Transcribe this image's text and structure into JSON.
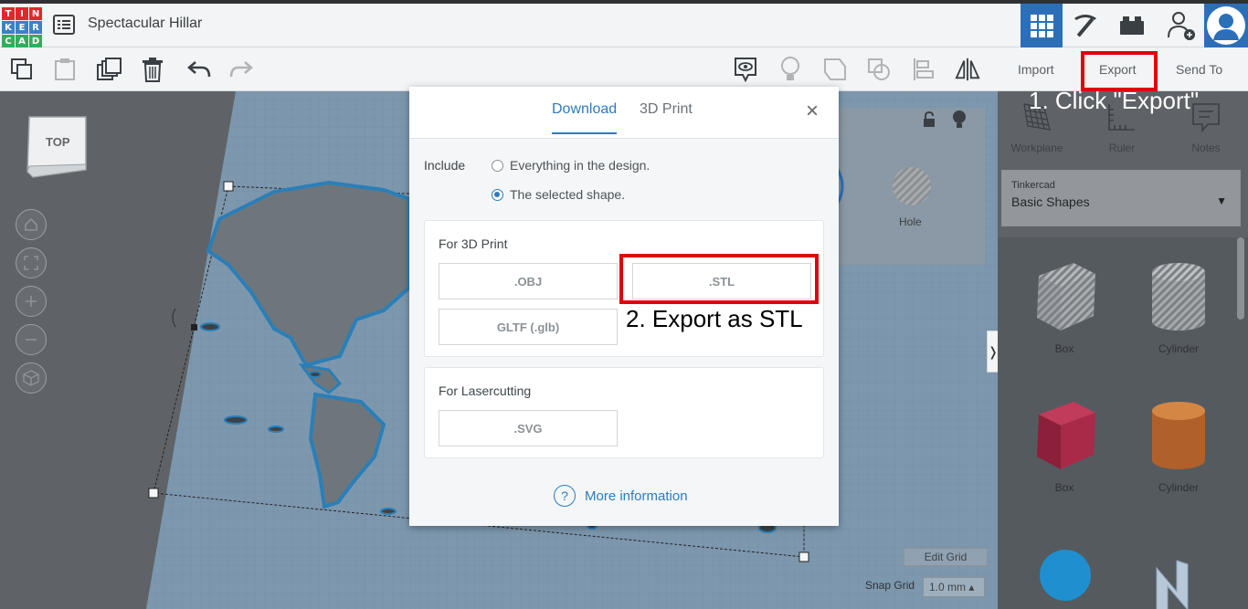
{
  "app": {
    "logo_letters": [
      "T",
      "I",
      "N",
      "K",
      "E",
      "R",
      "C",
      "A",
      "D"
    ],
    "logo_colors": [
      "#e2262e",
      "#e2262e",
      "#e2262e",
      "#3a82c4",
      "#3a82c4",
      "#3a82c4",
      "#2fae5d",
      "#2fae5d",
      "#2fae5d"
    ],
    "design_title": "Spectacular Hillar"
  },
  "toolbar": {
    "right_actions": {
      "import": "Import",
      "export": "Export",
      "send_to": "Send To"
    }
  },
  "right_panel": {
    "tools": [
      {
        "label": "Workplane",
        "icon": "workplane-icon"
      },
      {
        "label": "Ruler",
        "icon": "ruler-icon"
      },
      {
        "label": "Notes",
        "icon": "notes-icon"
      }
    ],
    "library": {
      "owner": "Tinkercad",
      "name": "Basic Shapes"
    },
    "shapes": [
      {
        "label": "Box",
        "kind": "box-striped"
      },
      {
        "label": "Cylinder",
        "kind": "cylinder-striped"
      },
      {
        "label": "Box",
        "kind": "box-red"
      },
      {
        "label": "Cylinder",
        "kind": "cylinder-orange"
      }
    ]
  },
  "workspace": {
    "viewcube_label": "TOP",
    "hole_label": "Hole",
    "edit_grid": "Edit Grid",
    "snap_grid_label": "Snap Grid",
    "snap_grid_value": "1.0 mm ▴"
  },
  "modal": {
    "tabs": [
      "Download",
      "3D Print"
    ],
    "active_tab": "Download",
    "close": "×",
    "include_label": "Include",
    "options": [
      {
        "label": "Everything in the design.",
        "checked": false
      },
      {
        "label": "The selected shape.",
        "checked": true
      }
    ],
    "sections": {
      "print": {
        "title": "For 3D Print",
        "formats": [
          ".OBJ",
          ".STL",
          "GLTF (.glb)"
        ]
      },
      "laser": {
        "title": "For Lasercutting",
        "formats": [
          ".SVG"
        ]
      }
    },
    "more_info": "More information",
    "help_glyph": "?"
  },
  "annotations": {
    "step1": "1. Click \"Export\"",
    "step2": "2. Export as STL",
    "highlight_color": "#e1000f"
  },
  "colors": {
    "accent": "#2d7bc0",
    "brand_blue": "#2c6fb8"
  }
}
